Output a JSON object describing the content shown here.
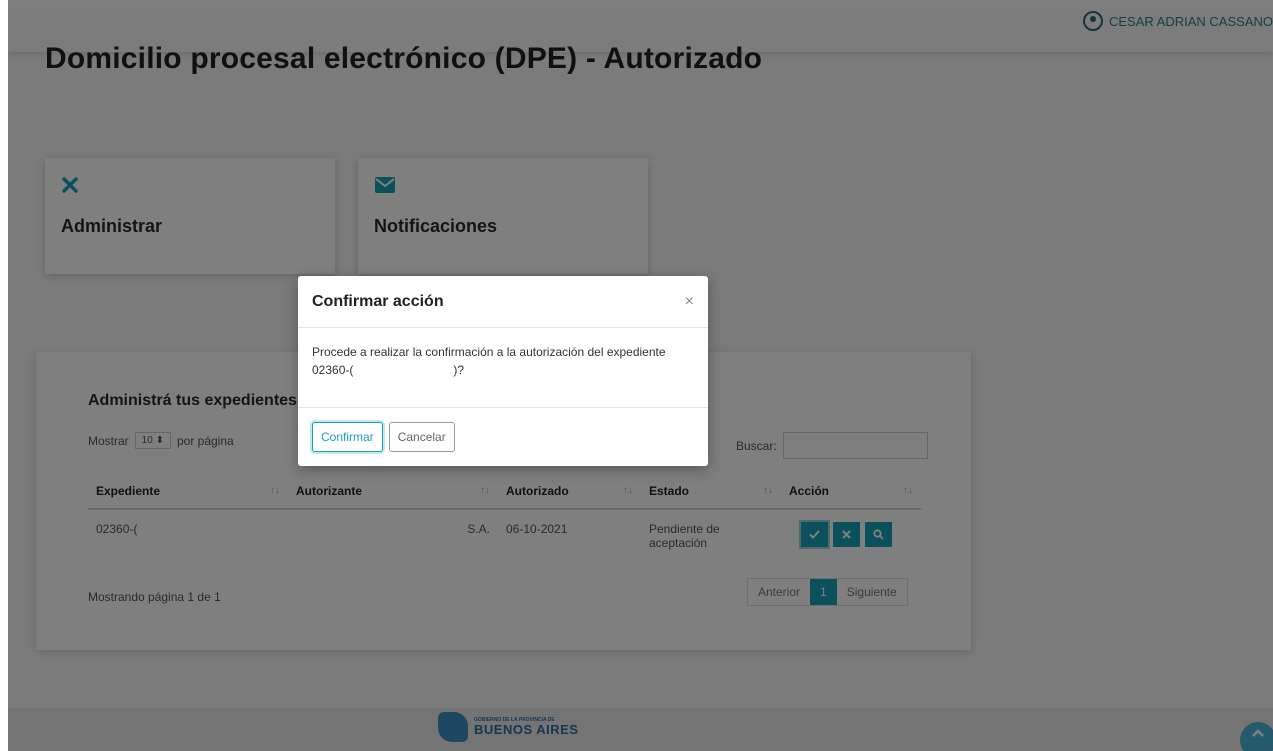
{
  "header": {
    "user_name": "CESAR ADRIAN CASSANO"
  },
  "page": {
    "title": "Domicilio procesal electrónico (DPE) - Autorizado"
  },
  "cards": [
    {
      "label": "Administrar",
      "icon": "close-icon"
    },
    {
      "label": "Notificaciones",
      "icon": "envelope-icon"
    }
  ],
  "panel": {
    "title": "Administrá tus expedientes",
    "show_prefix": "Mostrar",
    "page_size": "10",
    "show_suffix": "por página",
    "search_label": "Buscar:",
    "search_value": "",
    "columns": [
      "Expediente",
      "Autorizante",
      "Autorizado",
      "Estado",
      "Acción"
    ],
    "rows": [
      {
        "expediente": "02360-(",
        "autorizante": "S.A.",
        "autorizado": "06-10-2021",
        "estado": "Pendiente de aceptación"
      }
    ],
    "footer_info": "Mostrando página 1 de 1",
    "pager": {
      "prev": "Anterior",
      "current": "1",
      "next": "Siguiente"
    }
  },
  "modal": {
    "title": "Confirmar acción",
    "close": "×",
    "body_line1": "Procede a realizar la confirmación a la autorización del expediente",
    "body_line2": "02360-(                              )?",
    "confirm": "Confirmar",
    "cancel": "Cancelar"
  },
  "footer": {
    "logo_small": "GOBIERNO DE LA PROVINCIA DE",
    "logo_big": "BUENOS AIRES"
  },
  "colors": {
    "accent": "#17a2b8",
    "overlay": "rgba(0,0,0,0.5)"
  }
}
